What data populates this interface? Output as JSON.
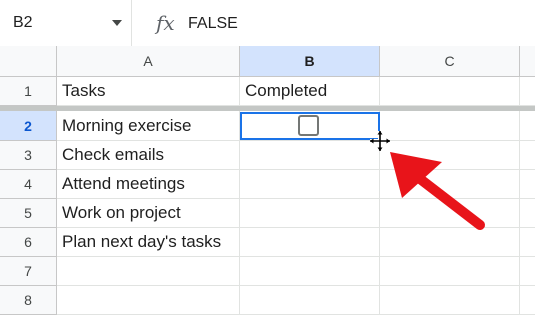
{
  "formula_bar": {
    "cell_ref": "B2",
    "fx_symbol": "fx",
    "formula_value": "FALSE"
  },
  "columns": [
    "A",
    "B",
    "C"
  ],
  "rows": [
    {
      "num": "1",
      "a": "Tasks",
      "b": "Completed"
    },
    {
      "num": "2",
      "a": "Morning exercise",
      "b": ""
    },
    {
      "num": "3",
      "a": "Check emails",
      "b": ""
    },
    {
      "num": "4",
      "a": "Attend meetings",
      "b": ""
    },
    {
      "num": "5",
      "a": "Work on project",
      "b": ""
    },
    {
      "num": "6",
      "a": "Plan next day's tasks",
      "b": ""
    },
    {
      "num": "7",
      "a": "",
      "b": ""
    },
    {
      "num": "8",
      "a": "",
      "b": ""
    }
  ],
  "selected_cell": "B2",
  "colors": {
    "selection_border": "#1a73e8",
    "header_selected_bg": "#d3e3fd",
    "annotation_arrow": "#e8141a"
  }
}
